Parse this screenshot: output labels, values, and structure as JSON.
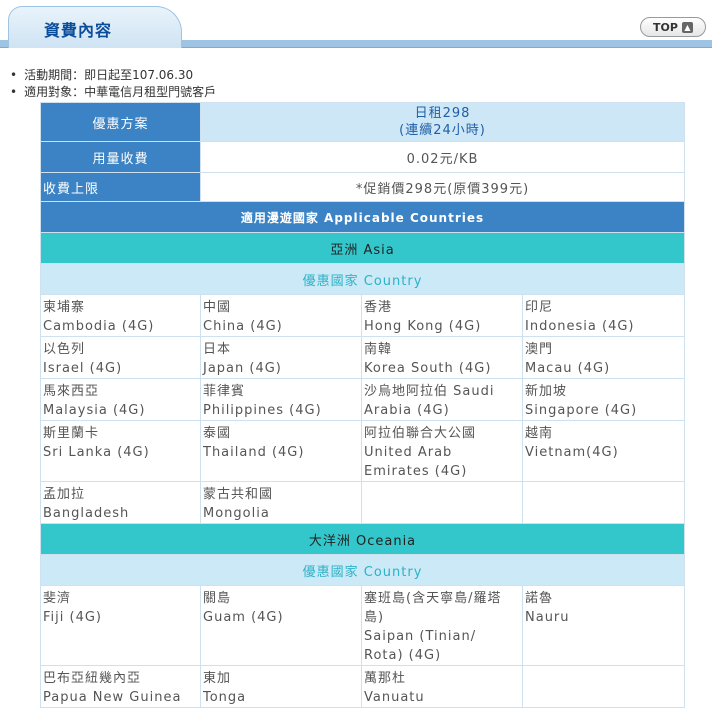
{
  "header": {
    "title": "資費內容",
    "top_button": "TOP"
  },
  "bullets": [
    "活動期間：即日起至107.06.30",
    "適用對象：中華電信月租型門號客戶"
  ],
  "plan": {
    "label": "優惠方案",
    "value_line1": "日租298",
    "value_line2": "(連續24小時)",
    "usage_label": "用量收費",
    "usage_value": "0.02元/KB",
    "cap_label": "收費上限",
    "cap_value": "*促銷價298元(原價399元)"
  },
  "applicable_title": "適用漫遊國家 Applicable Countries",
  "regions": {
    "asia": "亞洲 Asia",
    "oceania": "大洋洲 Oceania",
    "country_header": "優惠國家 Country"
  },
  "asia_rows": [
    [
      [
        "柬埔寨",
        "Cambodia (4G)"
      ],
      [
        "中國",
        "China (4G)"
      ],
      [
        "香港",
        "Hong Kong (4G)"
      ],
      [
        "印尼",
        "Indonesia (4G)"
      ]
    ],
    [
      [
        "以色列",
        "Israel (4G)"
      ],
      [
        "日本",
        "Japan (4G)"
      ],
      [
        "南韓",
        "Korea South (4G)"
      ],
      [
        "澳門",
        "Macau (4G)"
      ]
    ],
    [
      [
        "馬來西亞",
        "Malaysia (4G)"
      ],
      [
        "菲律賓",
        "Philippines (4G)"
      ],
      [
        "沙烏地阿拉伯 Saudi",
        "Arabia (4G)"
      ],
      [
        "新加坡",
        "Singapore (4G)"
      ]
    ],
    [
      [
        "斯里蘭卡",
        "Sri Lanka (4G)"
      ],
      [
        "泰國",
        "Thailand (4G)"
      ],
      [
        "阿拉伯聯合大公國",
        "United Arab",
        "Emirates (4G)"
      ],
      [
        "越南",
        "Vietnam(4G)"
      ]
    ],
    [
      [
        "孟加拉",
        "Bangladesh"
      ],
      [
        "蒙古共和國",
        "Mongolia"
      ]
    ]
  ],
  "oceania_rows": [
    [
      [
        "斐濟",
        "Fiji (4G)"
      ],
      [
        "關島",
        "Guam (4G)"
      ],
      [
        "塞班島(含天寧島/羅塔",
        "島)",
        "Saipan (Tinian/",
        "Rota) (4G)"
      ],
      [
        "諾魯",
        "Nauru"
      ]
    ],
    [
      [
        "巴布亞紐幾內亞",
        "Papua New Guinea"
      ],
      [
        "東加",
        "Tonga"
      ],
      [
        "萬那杜",
        "Vanuatu"
      ]
    ]
  ]
}
